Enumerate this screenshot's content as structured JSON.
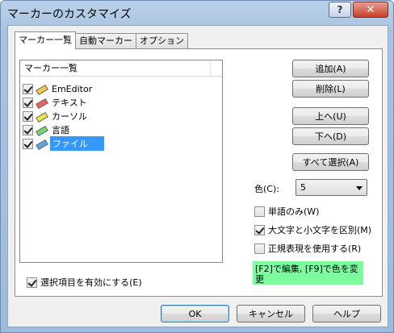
{
  "window": {
    "title": "マーカーのカスタマイズ",
    "help_label": "?",
    "close_label": "✕"
  },
  "tabs": [
    {
      "label": "マーカー一覧",
      "active": true
    },
    {
      "label": "自動マーカー",
      "active": false
    },
    {
      "label": "オプション",
      "active": false
    }
  ],
  "list": {
    "header": "マーカー一覧",
    "items": [
      {
        "label": "EmEditor",
        "checked": true,
        "icon_color": "#f7c948",
        "selected": false
      },
      {
        "label": "テキスト",
        "checked": true,
        "icon_color": "#f06060",
        "selected": false
      },
      {
        "label": "カーソル",
        "checked": true,
        "icon_color": "#e8e84a",
        "selected": false
      },
      {
        "label": "言語",
        "checked": true,
        "icon_color": "#6fd86f",
        "selected": false
      },
      {
        "label": "ファイル",
        "checked": true,
        "icon_color": "#5aa8e8",
        "selected": true
      }
    ]
  },
  "buttons": {
    "add": "追加(A)",
    "delete": "削除(L)",
    "up": "上へ(U)",
    "down": "下へ(D)",
    "select_all": "すべて選択(A)",
    "ok": "OK",
    "cancel": "キャンセル",
    "help": "ヘルプ"
  },
  "color": {
    "label": "色(C):",
    "value": "5"
  },
  "options": [
    {
      "label": "単語のみ(W)",
      "checked": false
    },
    {
      "label": "大文字と小文字を区別(M)",
      "checked": true
    },
    {
      "label": "正規表現を使用する(R)",
      "checked": false
    }
  ],
  "hint": "[F2]で編集, [F9]で色を変更",
  "enable_selected": {
    "label": "選択項目を有効にする(E)",
    "checked": true
  }
}
